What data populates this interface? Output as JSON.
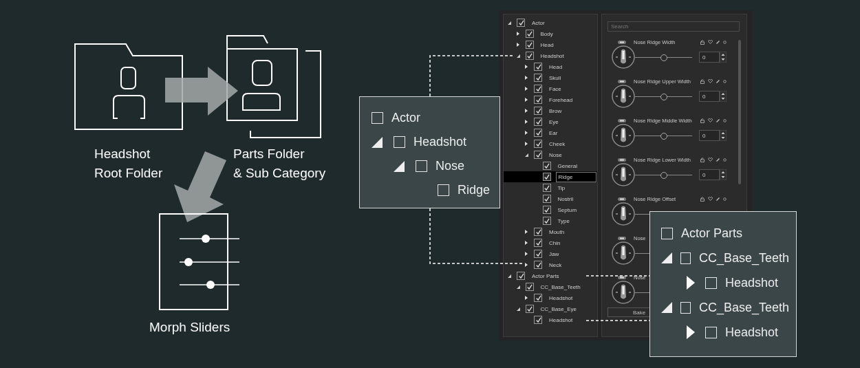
{
  "diagram": {
    "root_folder": {
      "label": [
        "Headshot",
        "Root Folder"
      ]
    },
    "parts_folder": {
      "label": [
        "Parts Folder",
        "& Sub Category"
      ]
    },
    "morph_sliders": {
      "label": [
        "Morph Sliders"
      ]
    }
  },
  "tree": [
    {
      "label": "Actor",
      "checked": true,
      "expanded": true,
      "selected": false,
      "children": [
        {
          "label": "Body",
          "checked": true,
          "expanded": false,
          "selected": false
        },
        {
          "label": "Head",
          "checked": true,
          "expanded": false,
          "selected": false
        },
        {
          "label": "Headshot",
          "checked": true,
          "expanded": true,
          "selected": false,
          "children": [
            {
              "label": "Head",
              "checked": true,
              "expanded": false,
              "selected": false
            },
            {
              "label": "Skull",
              "checked": true,
              "expanded": false,
              "selected": false
            },
            {
              "label": "Face",
              "checked": true,
              "expanded": false,
              "selected": false
            },
            {
              "label": "Forehead",
              "checked": true,
              "expanded": false,
              "selected": false
            },
            {
              "label": "Brow",
              "checked": true,
              "expanded": false,
              "selected": false
            },
            {
              "label": "Eye",
              "checked": true,
              "expanded": false,
              "selected": false
            },
            {
              "label": "Ear",
              "checked": true,
              "expanded": false,
              "selected": false
            },
            {
              "label": "Cheek",
              "checked": true,
              "expanded": false,
              "selected": false
            },
            {
              "label": "Nose",
              "checked": true,
              "expanded": true,
              "selected": false,
              "children": [
                {
                  "label": "General",
                  "checked": true,
                  "selected": false
                },
                {
                  "label": "Ridge",
                  "checked": true,
                  "selected": true
                },
                {
                  "label": "Tip",
                  "checked": true,
                  "selected": false
                },
                {
                  "label": "Nostril",
                  "checked": true,
                  "selected": false
                },
                {
                  "label": "Septum",
                  "checked": true,
                  "selected": false
                },
                {
                  "label": "Type",
                  "checked": true,
                  "selected": false
                }
              ]
            },
            {
              "label": "Mouth",
              "checked": true,
              "expanded": false,
              "selected": false
            },
            {
              "label": "Chin",
              "checked": true,
              "expanded": false,
              "selected": false
            },
            {
              "label": "Jaw",
              "checked": true,
              "expanded": false,
              "selected": false
            },
            {
              "label": "Neck",
              "checked": true,
              "expanded": false,
              "selected": false
            }
          ]
        }
      ]
    },
    {
      "label": "Actor Parts",
      "checked": true,
      "expanded": true,
      "selected": false,
      "children": [
        {
          "label": "CC_Base_Teeth",
          "checked": true,
          "expanded": true,
          "selected": false,
          "children": [
            {
              "label": "Headshot",
              "checked": true,
              "expanded": false,
              "selected": false
            }
          ]
        },
        {
          "label": "CC_Base_Eye",
          "checked": true,
          "expanded": true,
          "selected": false,
          "children": [
            {
              "label": "Headshot",
              "checked": true,
              "selected": false
            }
          ]
        }
      ]
    }
  ],
  "slider_panel": {
    "search": {
      "placeholder": "Search"
    },
    "sliders": [
      {
        "kind": "full",
        "name": "Nose Ridge Width",
        "level": 0.5,
        "value": "0"
      },
      {
        "kind": "full",
        "name": "Nose Ridge Upper Width",
        "level": 0.5,
        "value": "0"
      },
      {
        "kind": "full",
        "name": "Nose Ridge Middle Width",
        "level": 0.5,
        "value": "0"
      },
      {
        "kind": "full",
        "name": "Nose Ridge Lower Width",
        "level": 0.5,
        "value": "0"
      },
      {
        "kind": "no_value",
        "name": "Nose Ridge Offset"
      },
      {
        "kind": "title_only",
        "name": "Nose"
      },
      {
        "kind": "title_only",
        "name": "Nose"
      }
    ],
    "buttons": [
      "Bake"
    ]
  },
  "callouts": [
    {
      "items": [
        {
          "label": "Actor",
          "checked": false,
          "children": [
            {
              "label": "Headshot",
              "checked": false,
              "expanded": true,
              "children": [
                {
                  "label": "Nose",
                  "checked": false,
                  "expanded": true,
                  "children": [
                    {
                      "label": "Ridge",
                      "checked": false
                    }
                  ]
                }
              ]
            }
          ]
        }
      ]
    },
    {
      "items": [
        {
          "label": "Actor Parts",
          "checked": false,
          "children": [
            {
              "label": "CC_Base_Teeth",
              "checked": false,
              "expanded": true,
              "children": [
                {
                  "label": "Headshot",
                  "checked": false,
                  "expanded": false
                }
              ]
            },
            {
              "label": "CC_Base_Teeth",
              "checked": false,
              "expanded": true,
              "children": [
                {
                  "label": "Headshot",
                  "checked": false,
                  "expanded": false
                }
              ]
            }
          ]
        }
      ]
    }
  ]
}
